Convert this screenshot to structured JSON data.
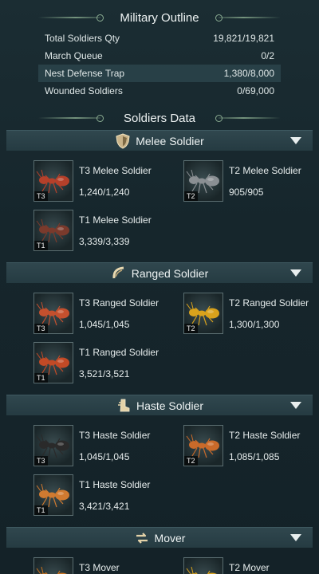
{
  "outline": {
    "title": "Military Outline",
    "rows": [
      {
        "label": "Total Soldiers Qty",
        "value": "19,821/19,821"
      },
      {
        "label": "March Queue",
        "value": "0/2"
      },
      {
        "label": "Nest Defense Trap",
        "value": "1,380/8,000"
      },
      {
        "label": "Wounded Soldiers",
        "value": "0/69,000"
      }
    ]
  },
  "soldiers_data": {
    "title": "Soldiers Data",
    "categories": [
      {
        "label": "Melee Soldier",
        "icon": "shield-icon",
        "units": [
          {
            "name": "T3 Melee Soldier",
            "qty": "1,240/1,240",
            "tier": "T3",
            "color": "#b5402a"
          },
          {
            "name": "T2 Melee Soldier",
            "qty": "905/905",
            "tier": "T2",
            "color": "#8a8f93"
          },
          {
            "name": "T1 Melee Soldier",
            "qty": "3,339/3,339",
            "tier": "T1",
            "color": "#7a3a2c"
          }
        ]
      },
      {
        "label": "Ranged Soldier",
        "icon": "bow-icon",
        "units": [
          {
            "name": "T3 Ranged Soldier",
            "qty": "1,045/1,045",
            "tier": "T3",
            "color": "#c4502e"
          },
          {
            "name": "T2 Ranged Soldier",
            "qty": "1,300/1,300",
            "tier": "T2",
            "color": "#d9a21c"
          },
          {
            "name": "T1 Ranged Soldier",
            "qty": "3,521/3,521",
            "tier": "T1",
            "color": "#c24a26"
          }
        ]
      },
      {
        "label": "Haste Soldier",
        "icon": "boot-icon",
        "units": [
          {
            "name": "T3 Haste Soldier",
            "qty": "1,045/1,045",
            "tier": "T3",
            "color": "#2a2a2a"
          },
          {
            "name": "T2 Haste Soldier",
            "qty": "1,085/1,085",
            "tier": "T2",
            "color": "#c96a2a"
          },
          {
            "name": "T1 Haste Soldier",
            "qty": "3,421/3,421",
            "tier": "T1",
            "color": "#d07a30"
          }
        ]
      },
      {
        "label": "Mover",
        "icon": "arrows-icon",
        "units": [
          {
            "name": "T3 Mover",
            "qty": "",
            "tier": "T3",
            "color": "#c9721e"
          },
          {
            "name": "T2 Mover",
            "qty": "",
            "tier": "T2",
            "color": "#d9a21c"
          }
        ]
      }
    ]
  }
}
